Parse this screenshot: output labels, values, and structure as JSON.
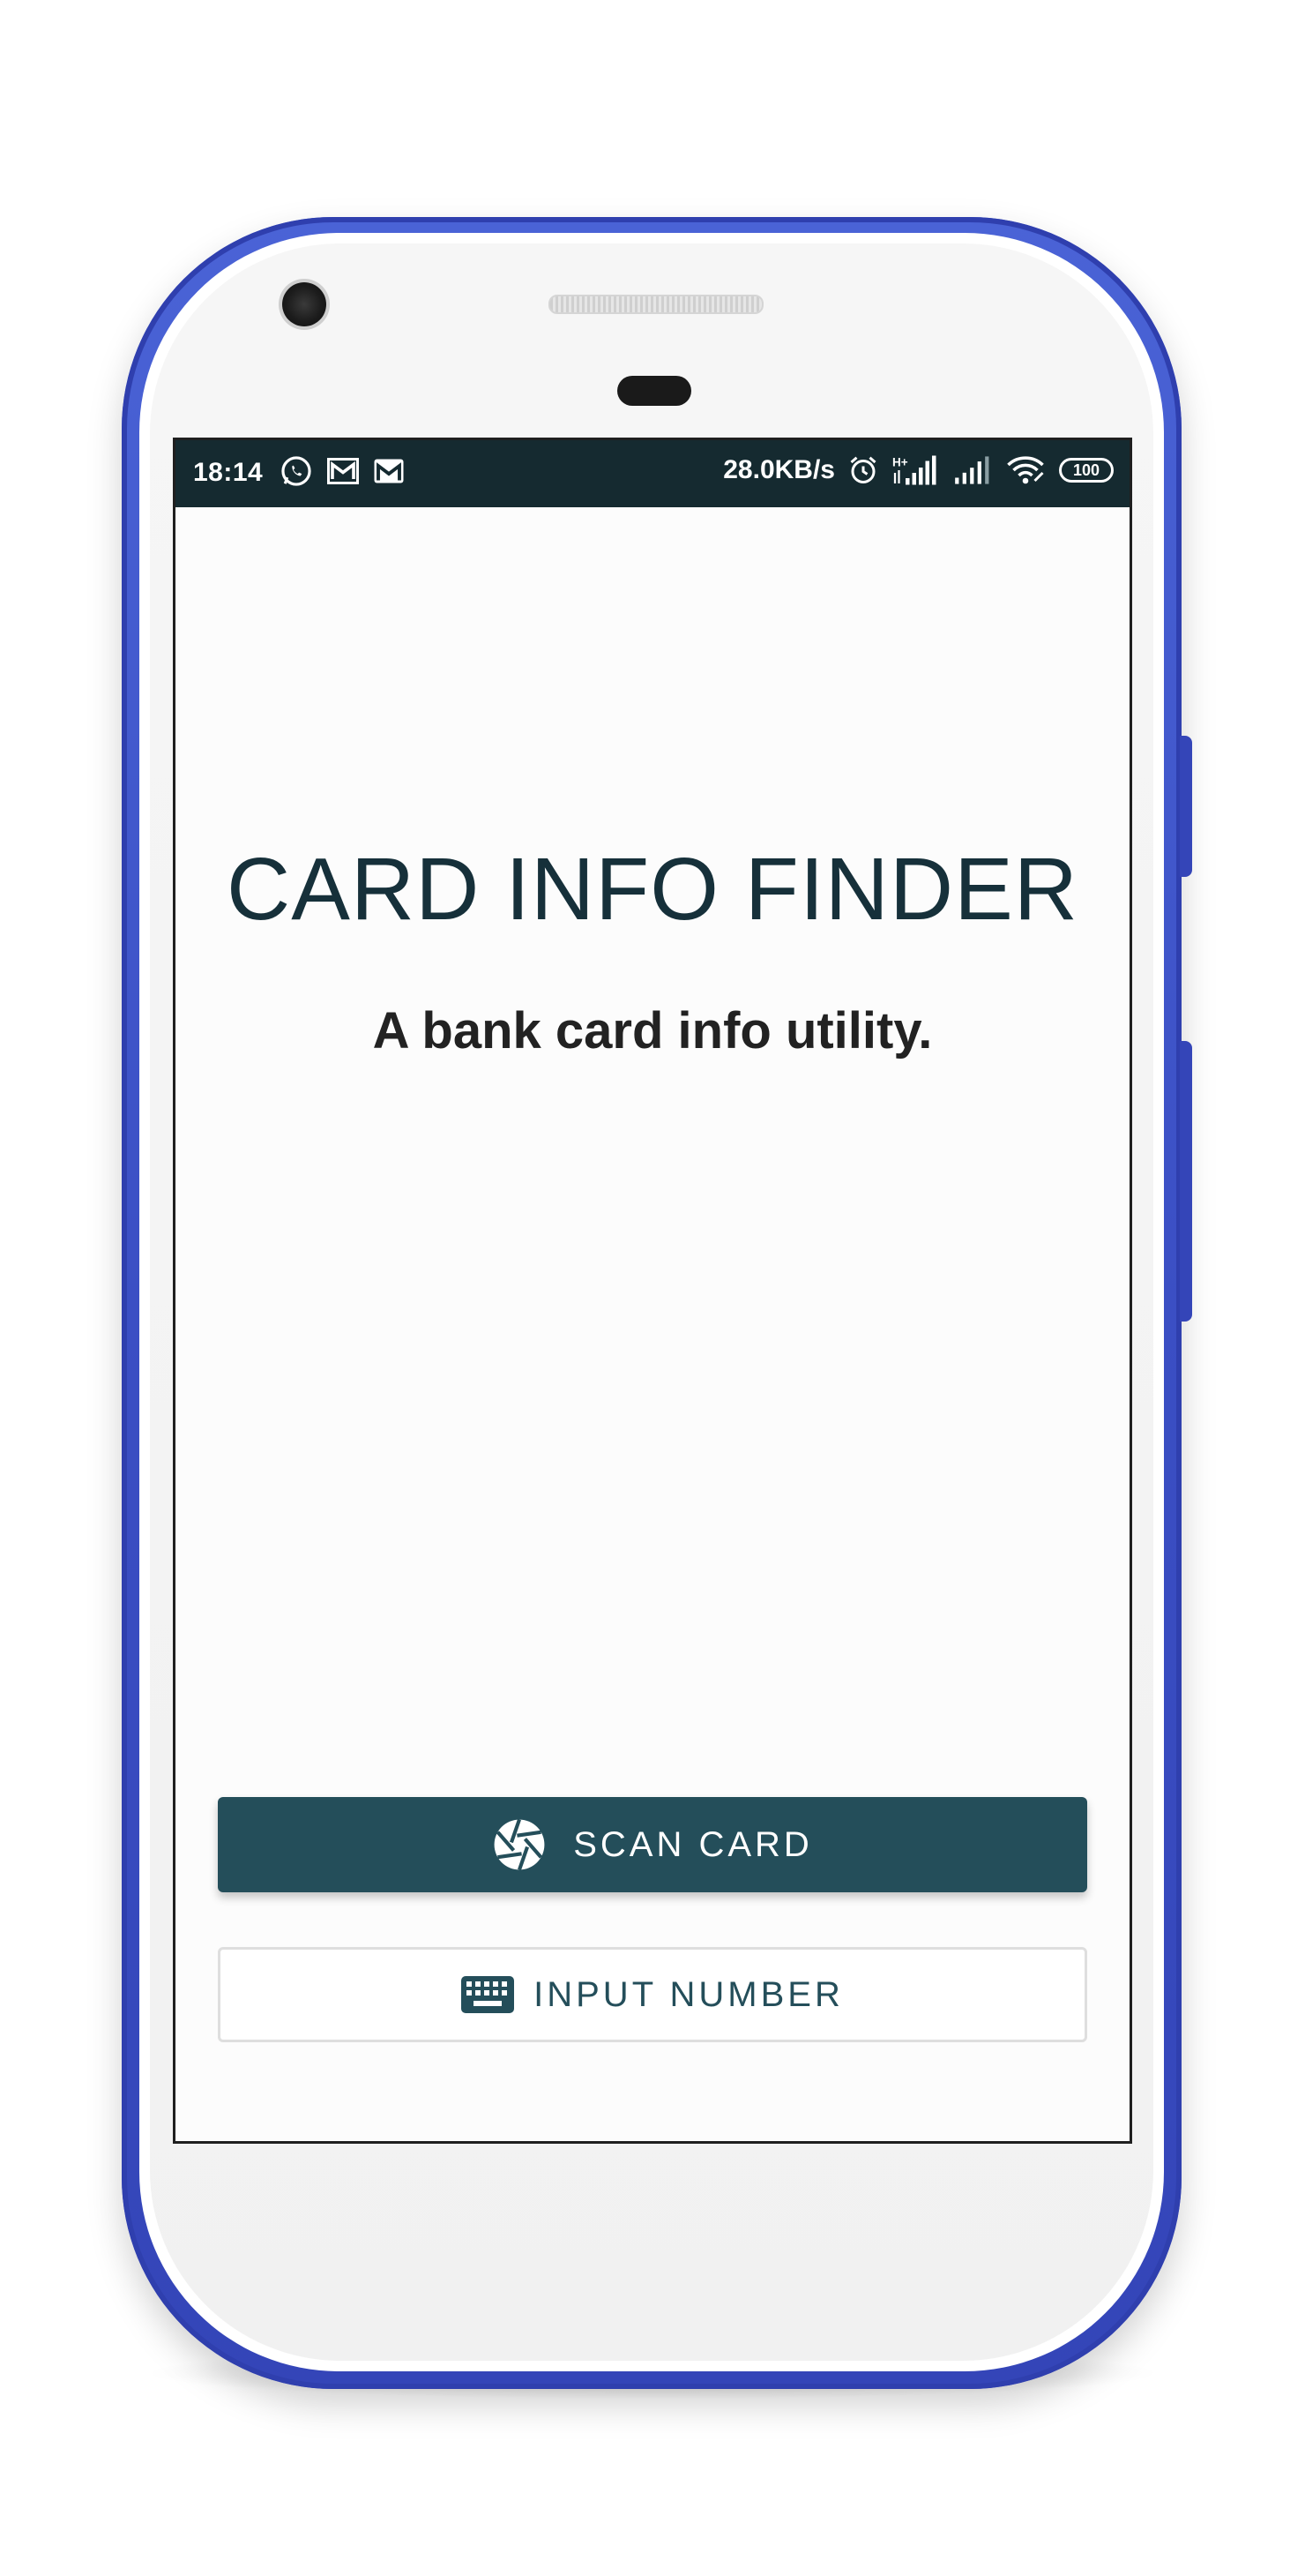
{
  "status_bar": {
    "time": "18:14",
    "left_icons": [
      "whatsapp-icon",
      "gallery-mail-icon",
      "gmail-icon"
    ],
    "network_speed": "28.0KB/s",
    "right_icons": [
      "alarm-icon",
      "signal-h-plus-icon",
      "signal-icon",
      "wifi-icon"
    ],
    "battery_level": "100"
  },
  "app": {
    "title": "CARD INFO FINDER",
    "subtitle": "A bank card info utility."
  },
  "actions": {
    "scan_label": "SCAN CARD",
    "scan_icon": "camera-shutter-icon",
    "input_label": "INPUT NUMBER",
    "input_icon": "keyboard-icon"
  },
  "colors": {
    "status_bar_bg": "#152a30",
    "primary": "#244e5a",
    "title_text": "#16303a",
    "phone_frame": "#3b4fc4"
  }
}
